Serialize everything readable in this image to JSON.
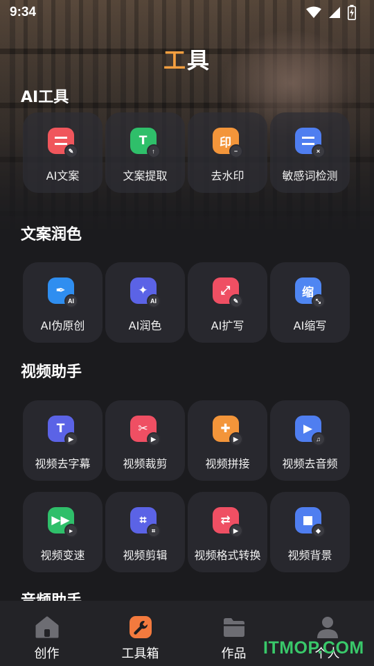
{
  "status_bar": {
    "time": "9:34",
    "icons": [
      "wifi-icon",
      "signal-icon",
      "battery-charging-icon"
    ]
  },
  "page": {
    "title_first": "工",
    "title_rest": "具"
  },
  "sections": [
    {
      "title": "AI工具",
      "items": [
        {
          "label": "AI文案",
          "color": "#f0565c",
          "glyph": "",
          "icon": "ai-copywriting-icon",
          "badge": "✎"
        },
        {
          "label": "文案提取",
          "color": "#2fbf6a",
          "glyph": "T",
          "icon": "text-extract-icon",
          "badge": "↑"
        },
        {
          "label": "去水印",
          "color": "#f3953a",
          "glyph": "印",
          "icon": "remove-watermark-icon",
          "badge": "−"
        },
        {
          "label": "敏感词检测",
          "color": "#4f7ef0",
          "glyph": "",
          "icon": "sensitive-word-icon",
          "badge": "×"
        }
      ]
    },
    {
      "title": "文案润色",
      "items": [
        {
          "label": "AI伪原创",
          "color": "#2f8ef0",
          "glyph": "✒",
          "icon": "ai-rewrite-icon",
          "badge": "AI"
        },
        {
          "label": "AI润色",
          "color": "#5b63e6",
          "glyph": "✦",
          "icon": "ai-polish-icon",
          "badge": "AI"
        },
        {
          "label": "AI扩写",
          "color": "#ef4f63",
          "glyph": "⤢",
          "icon": "ai-expand-icon",
          "badge": "✎"
        },
        {
          "label": "AI缩写",
          "color": "#4f86f2",
          "glyph": "缩",
          "icon": "ai-abbreviate-icon",
          "badge": "⤡"
        }
      ]
    },
    {
      "title": "视频助手",
      "items": [
        {
          "label": "视频去字幕",
          "color": "#5b63e6",
          "glyph": "T",
          "icon": "video-remove-subtitle-icon",
          "badge": "▶"
        },
        {
          "label": "视频裁剪",
          "color": "#ef4f63",
          "glyph": "✂",
          "icon": "video-cut-icon",
          "badge": "▶"
        },
        {
          "label": "视频拼接",
          "color": "#f3953a",
          "glyph": "✚",
          "icon": "video-merge-icon",
          "badge": "▶"
        },
        {
          "label": "视频去音频",
          "color": "#4f7ef0",
          "glyph": "▶",
          "icon": "video-remove-audio-icon",
          "badge": "♫"
        },
        {
          "label": "视频变速",
          "color": "#2fbf6a",
          "glyph": "▶▶",
          "icon": "video-speed-icon",
          "badge": "▸"
        },
        {
          "label": "视频剪辑",
          "color": "#5b63e6",
          "glyph": "⌗",
          "icon": "video-edit-icon",
          "badge": "⌗"
        },
        {
          "label": "视频格式转换",
          "color": "#ef4f63",
          "glyph": "⇄",
          "icon": "video-format-convert-icon",
          "badge": "▶"
        },
        {
          "label": "视频背景",
          "color": "#4f7ef0",
          "glyph": "■",
          "icon": "video-background-icon",
          "badge": "◆"
        }
      ]
    },
    {
      "title": "音频助手",
      "items": []
    }
  ],
  "tabbar": [
    {
      "label": "创作",
      "icon": "home-icon",
      "active": false
    },
    {
      "label": "工具箱",
      "icon": "wrench-icon",
      "active": true
    },
    {
      "label": "作品",
      "icon": "folder-icon",
      "active": false
    },
    {
      "label": "个人",
      "icon": "person-icon",
      "active": false
    }
  ],
  "watermark": "ITMOP.COM",
  "colors": {
    "accent": "#f5a040",
    "background": "#1b1b1e",
    "tile": "#2e2e34",
    "tabbar": "#232327"
  }
}
